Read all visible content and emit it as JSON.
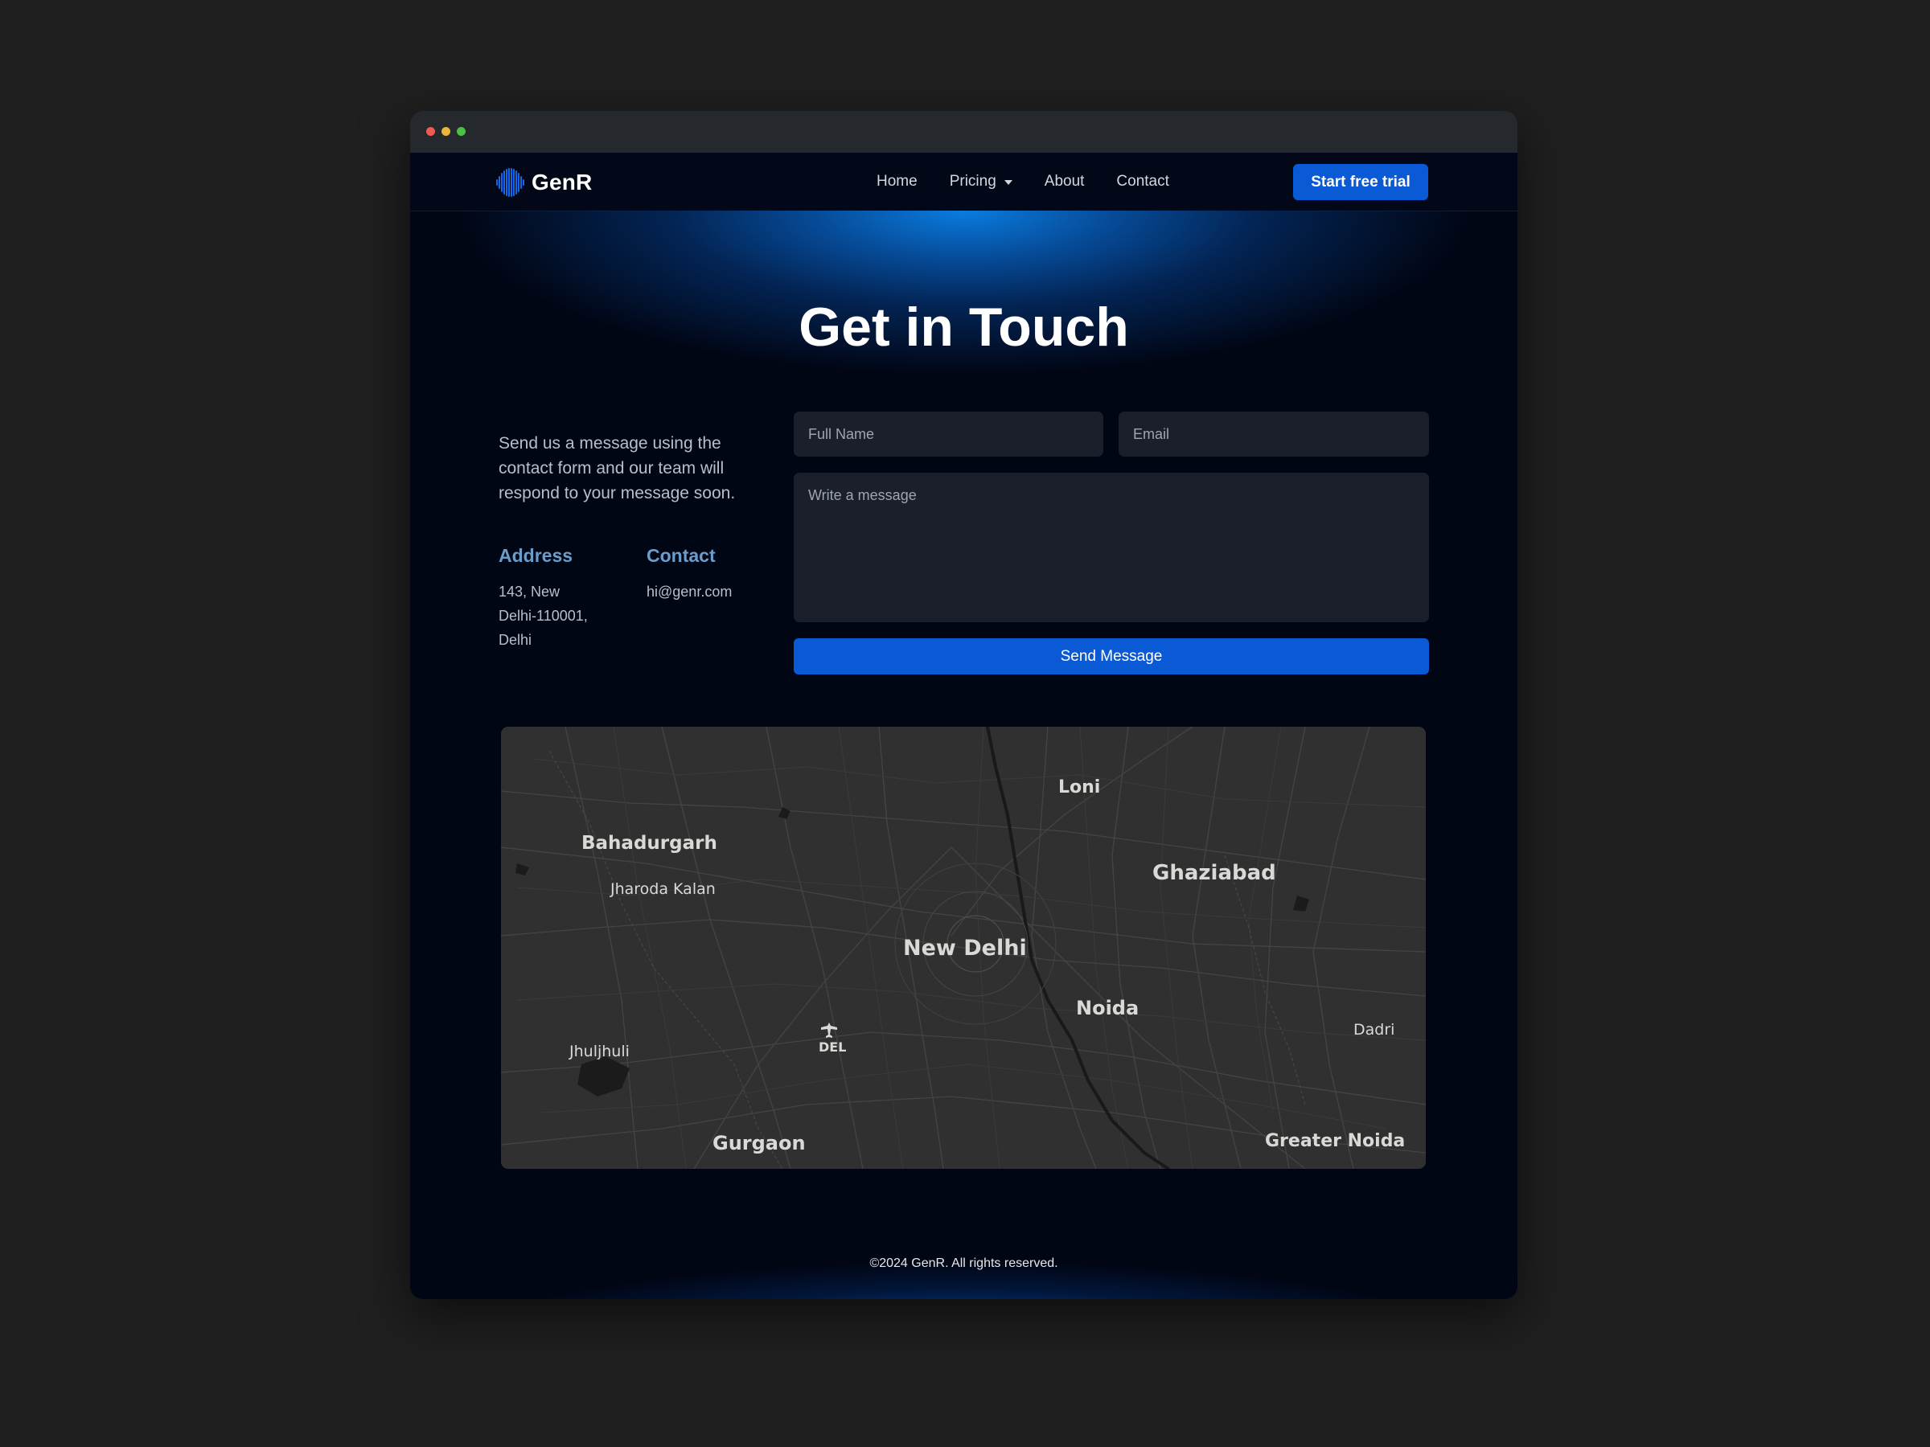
{
  "window": {
    "controls": [
      "close",
      "minimize",
      "maximize"
    ]
  },
  "brand": {
    "name": "GenR",
    "logo_icon": "waveform-icon",
    "color": "#0a5ad6"
  },
  "nav": {
    "links": [
      {
        "label": "Home"
      },
      {
        "label": "Pricing",
        "has_dropdown": true
      },
      {
        "label": "About"
      },
      {
        "label": "Contact"
      }
    ],
    "cta_label": "Start free trial"
  },
  "hero": {
    "title": "Get in Touch"
  },
  "intro": {
    "text": "Send us a message using the contact form and our team will respond to your message soon."
  },
  "address": {
    "title": "Address",
    "text": "143, New Delhi-110001, Delhi"
  },
  "contact": {
    "title": "Contact",
    "email": "hi@genr.com"
  },
  "form": {
    "name_placeholder": "Full Name",
    "email_placeholder": "Email",
    "message_placeholder": "Write a message",
    "submit_label": "Send Message"
  },
  "map": {
    "labels": {
      "loni": "Loni",
      "bahadurgarh": "Bahadurgarh",
      "ghaziabad": "Ghaziabad",
      "jharoda": "Jharoda Kalan",
      "new_delhi": "New Delhi",
      "noida": "Noida",
      "dadri": "Dadri",
      "jhuljhuli": "Jhuljhuli",
      "airport": "DEL",
      "gurgaon": "Gurgaon",
      "greater_noida": "Greater Noida"
    },
    "airport_icon": "airplane-icon"
  },
  "footer": {
    "copyright": "©2024 GenR. All rights reserved."
  }
}
